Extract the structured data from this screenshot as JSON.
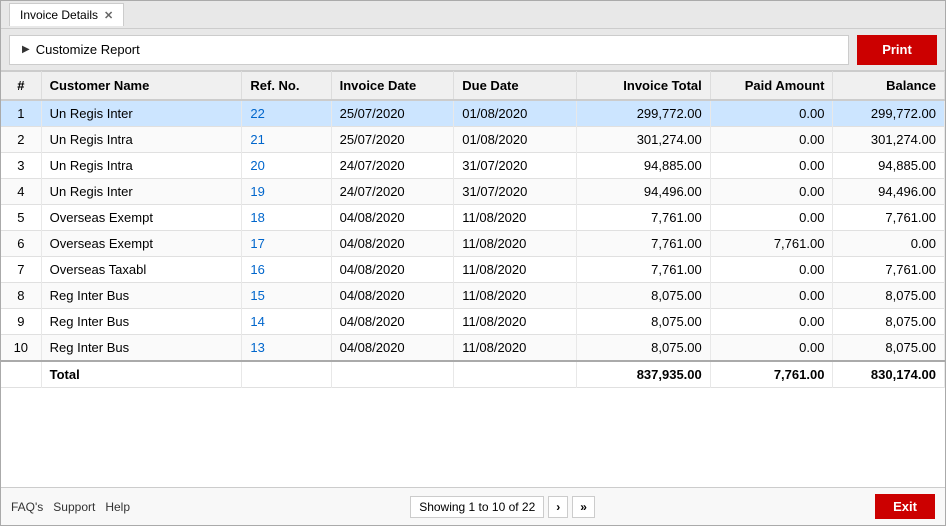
{
  "window": {
    "title": "Invoice Details",
    "tab_label": "Invoice Details"
  },
  "toolbar": {
    "customize_label": "Customize Report",
    "print_label": "Print"
  },
  "table": {
    "columns": [
      "#",
      "Customer Name",
      "Ref. No.",
      "Invoice Date",
      "Due Date",
      "Invoice Total",
      "Paid Amount",
      "Balance"
    ],
    "rows": [
      {
        "num": 1,
        "customer": "Un Regis Inter",
        "ref": "22",
        "inv_date": "25/07/2020",
        "due_date": "01/08/2020",
        "total": "299,772.00",
        "paid": "0.00",
        "balance": "299,772.00",
        "selected": true
      },
      {
        "num": 2,
        "customer": "Un Regis Intra",
        "ref": "21",
        "inv_date": "25/07/2020",
        "due_date": "01/08/2020",
        "total": "301,274.00",
        "paid": "0.00",
        "balance": "301,274.00",
        "selected": false
      },
      {
        "num": 3,
        "customer": "Un Regis Intra",
        "ref": "20",
        "inv_date": "24/07/2020",
        "due_date": "31/07/2020",
        "total": "94,885.00",
        "paid": "0.00",
        "balance": "94,885.00",
        "selected": false
      },
      {
        "num": 4,
        "customer": "Un Regis Inter",
        "ref": "19",
        "inv_date": "24/07/2020",
        "due_date": "31/07/2020",
        "total": "94,496.00",
        "paid": "0.00",
        "balance": "94,496.00",
        "selected": false
      },
      {
        "num": 5,
        "customer": "Overseas Exempt",
        "ref": "18",
        "inv_date": "04/08/2020",
        "due_date": "11/08/2020",
        "total": "7,761.00",
        "paid": "0.00",
        "balance": "7,761.00",
        "selected": false
      },
      {
        "num": 6,
        "customer": "Overseas Exempt",
        "ref": "17",
        "inv_date": "04/08/2020",
        "due_date": "11/08/2020",
        "total": "7,761.00",
        "paid": "7,761.00",
        "balance": "0.00",
        "selected": false
      },
      {
        "num": 7,
        "customer": "Overseas Taxabl",
        "ref": "16",
        "inv_date": "04/08/2020",
        "due_date": "11/08/2020",
        "total": "7,761.00",
        "paid": "0.00",
        "balance": "7,761.00",
        "selected": false
      },
      {
        "num": 8,
        "customer": "Reg Inter Bus",
        "ref": "15",
        "inv_date": "04/08/2020",
        "due_date": "11/08/2020",
        "total": "8,075.00",
        "paid": "0.00",
        "balance": "8,075.00",
        "selected": false
      },
      {
        "num": 9,
        "customer": "Reg Inter Bus",
        "ref": "14",
        "inv_date": "04/08/2020",
        "due_date": "11/08/2020",
        "total": "8,075.00",
        "paid": "0.00",
        "balance": "8,075.00",
        "selected": false
      },
      {
        "num": 10,
        "customer": "Reg Inter Bus",
        "ref": "13",
        "inv_date": "04/08/2020",
        "due_date": "11/08/2020",
        "total": "8,075.00",
        "paid": "0.00",
        "balance": "8,075.00",
        "selected": false
      }
    ],
    "total_row": {
      "label": "Total",
      "total": "837,935.00",
      "paid": "7,761.00",
      "balance": "830,174.00"
    }
  },
  "pagination": {
    "info": "Showing 1 to 10 of 22",
    "next_label": "›",
    "last_label": "»"
  },
  "footer": {
    "links": [
      "FAQ's",
      "Support",
      "Help"
    ],
    "exit_label": "Exit"
  }
}
